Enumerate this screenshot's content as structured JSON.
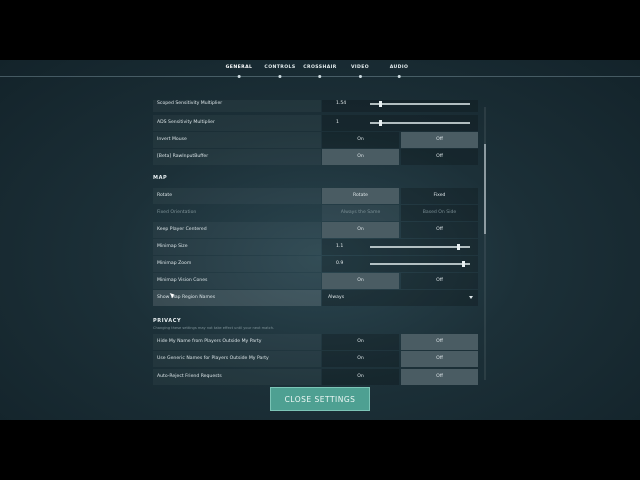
{
  "tabs": [
    {
      "label": "GENERAL",
      "active": true
    },
    {
      "label": "CONTROLS",
      "active": false
    },
    {
      "label": "CROSSHAIR",
      "active": false
    },
    {
      "label": "VIDEO",
      "active": false
    },
    {
      "label": "AUDIO",
      "active": false
    }
  ],
  "settings": {
    "scoped_sensitivity": {
      "label": "Scoped Sensitivity Multiplier",
      "value": "1.54"
    },
    "ads_sensitivity": {
      "label": "ADS Sensitivity Multiplier",
      "value": "1"
    },
    "invert_mouse": {
      "label": "Invert Mouse",
      "on": "On",
      "off": "Off"
    },
    "raw_input": {
      "label": "[Beta] RawInputBuffer",
      "on": "On",
      "off": "Off"
    }
  },
  "map": {
    "title": "MAP",
    "rotate": {
      "label": "Rotate",
      "opt1": "Rotate",
      "opt2": "Fixed"
    },
    "fixed_orientation": {
      "label": "Fixed Orientation",
      "opt1": "Always the Same",
      "opt2": "Based On Side"
    },
    "keep_centered": {
      "label": "Keep Player Centered",
      "on": "On",
      "off": "Off"
    },
    "minimap_size": {
      "label": "Minimap Size",
      "value": "1.1",
      "level": 0.9
    },
    "minimap_zoom": {
      "label": "Minimap Zoom",
      "value": "0.9",
      "level": 0.95
    },
    "vision_cones": {
      "label": "Minimap Vision Cones",
      "on": "On",
      "off": "Off"
    },
    "region_names": {
      "label": "Show Map Region Names",
      "value": "Always"
    }
  },
  "privacy": {
    "title": "PRIVACY",
    "note": "Changing these settings may not take effect until your next match.",
    "hide_name": {
      "label": "Hide My Name from Players Outside My Party",
      "on": "On",
      "off": "Off"
    },
    "generic_names": {
      "label": "Use Generic Names for Players Outside My Party",
      "on": "On",
      "off": "Off"
    },
    "auto_reject": {
      "label": "Auto-Reject Friend Requests",
      "on": "On",
      "off": "Off"
    }
  },
  "close_button": "CLOSE SETTINGS",
  "icons": {
    "dropdown": "chevron-down-icon",
    "cursor": "mouse-cursor-icon"
  }
}
